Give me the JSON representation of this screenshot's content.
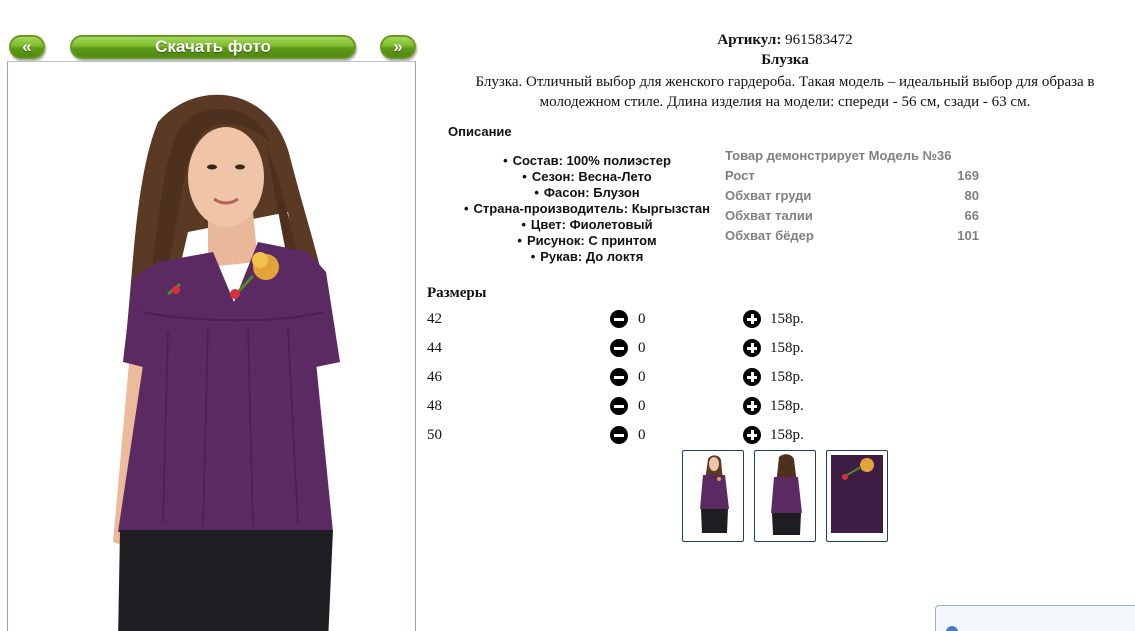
{
  "gallery": {
    "prev_label": "«",
    "download_label": "Скачать фото",
    "next_label": "»"
  },
  "product": {
    "sku_label": "Артикул:",
    "sku_value": "961583472",
    "title": "Блузка",
    "description": "Блузка. Отличный выбор для женского гардероба. Такая модель – идеальный выбор для образа в молодежном стиле. Длина изделия на модели: спереди - 56 см, сзади - 63 см."
  },
  "description_section": {
    "label": "Описание",
    "attributes": [
      "Состав: 100% полиэстер",
      "Сезон: Весна-Лето",
      "Фасон: Блузон",
      "Страна-производитель: Кыргызстан",
      "Цвет: Фиолетовый",
      "Рисунок: С принтом",
      "Рукав: До локтя"
    ]
  },
  "model_info": {
    "heading": "Товар демонстрирует Модель №36",
    "rows": [
      {
        "label": "Рост",
        "value": "169"
      },
      {
        "label": "Обхват груди",
        "value": "80"
      },
      {
        "label": "Обхват талии",
        "value": "66"
      },
      {
        "label": "Обхват бёдер",
        "value": "101"
      }
    ]
  },
  "sizes": {
    "label": "Размеры",
    "rows": [
      {
        "size": "42",
        "qty": "0",
        "price": "158р."
      },
      {
        "size": "44",
        "qty": "0",
        "price": "158р."
      },
      {
        "size": "46",
        "qty": "0",
        "price": "158р."
      },
      {
        "size": "48",
        "qty": "0",
        "price": "158р."
      },
      {
        "size": "50",
        "qty": "0",
        "price": "158р."
      }
    ]
  },
  "colors": {
    "blouse": "#5b2a63",
    "accent_green": "#6fae22"
  }
}
